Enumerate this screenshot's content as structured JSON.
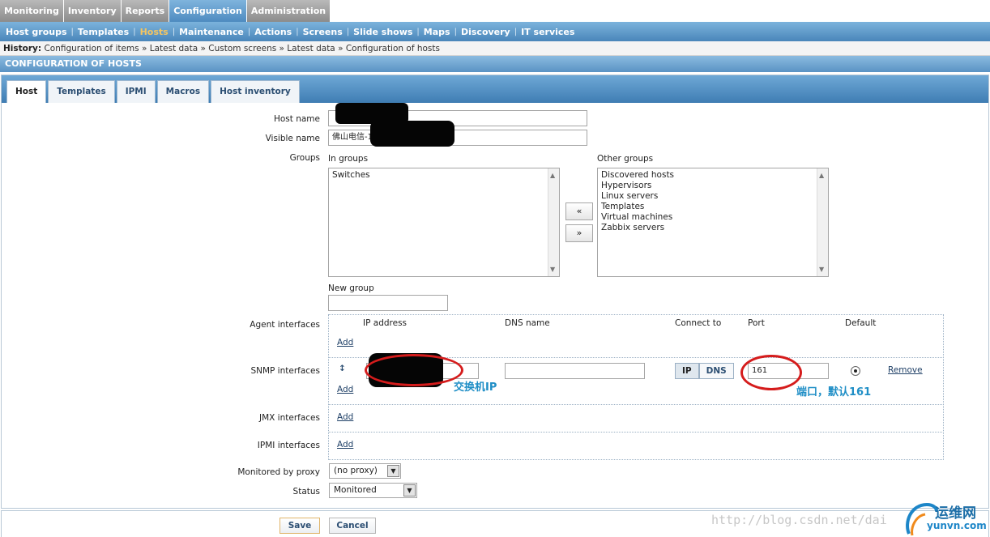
{
  "topmenu": [
    "Monitoring",
    "Inventory",
    "Reports",
    "Configuration",
    "Administration"
  ],
  "submenu": [
    "Host groups",
    "Templates",
    "Hosts",
    "Maintenance",
    "Actions",
    "Screens",
    "Slide shows",
    "Maps",
    "Discovery",
    "IT services"
  ],
  "history": {
    "label": "History:",
    "text": "Configuration of items » Latest data » Custom screens » Latest data » Configuration of hosts"
  },
  "page_title": "CONFIGURATION OF HOSTS",
  "tabs": [
    "Host",
    "Templates",
    "IPMI",
    "Macros",
    "Host inventory"
  ],
  "form": {
    "host_name_label": "Host name",
    "visible_name_label": "Visible name",
    "visible_name_value": "佛山电信-1",
    "groups_label": "Groups",
    "in_groups_label": "In groups",
    "other_groups_label": "Other groups",
    "in_groups": [
      "Switches"
    ],
    "other_groups": [
      "Discovered hosts",
      "Hypervisors",
      "Linux servers",
      "Templates",
      "Virtual machines",
      "Zabbix servers"
    ],
    "move_left": "«",
    "move_right": "»",
    "new_group_label": "New group",
    "agent_interfaces_label": "Agent interfaces",
    "snmp_interfaces_label": "SNMP interfaces",
    "jmx_interfaces_label": "JMX interfaces",
    "ipmi_interfaces_label": "IPMI interfaces",
    "col_ip": "IP address",
    "col_dns": "DNS name",
    "col_connect": "Connect to",
    "col_port": "Port",
    "col_default": "Default",
    "add_link": "Add",
    "remove_link": "Remove",
    "connect_ip": "IP",
    "connect_dns": "DNS",
    "snmp_port": "161",
    "proxy_label": "Monitored by proxy",
    "proxy_value": "(no proxy)",
    "status_label": "Status",
    "status_value": "Monitored"
  },
  "annotations": {
    "switch_ip": "交换机IP",
    "port_default": "端口，默认161"
  },
  "buttons": {
    "save": "Save",
    "cancel": "Cancel"
  },
  "watermark": "http://blog.csdn.net/dai",
  "logo": {
    "text": "运维网",
    "sub": "yunvn.com"
  }
}
